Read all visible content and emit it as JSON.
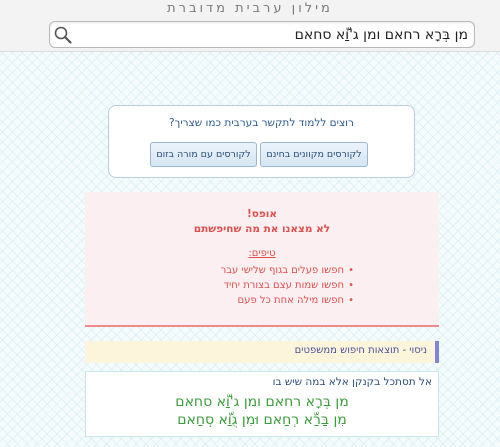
{
  "header": {
    "site_title": "מילון ערבית מדוברת"
  },
  "search": {
    "value": "מן בְּרָא רחאם ומן ג'וַّא סחאם",
    "icon": "search-icon"
  },
  "promo": {
    "title": "רוצים ללמוד לתקשר בערבית כמו שצריך?",
    "button_recorded": "לקורסים מקוונים בחינם",
    "button_zoom": "לקורסים עם מורה בזום"
  },
  "error": {
    "title": "אופס!",
    "subtitle": "לא מצאנו את מה שחיפשתם",
    "tips_label": "טיפים:",
    "tips": [
      "חפשו פעלים בגוף שלישי עבר",
      "חפשו שמות עצם בצורת יחיד",
      "חפשו מילה אחת כל פעם"
    ],
    "color": "#e0504e"
  },
  "attempt": {
    "label": "ניסוי - תוצאות חיפוש ממשפטים"
  },
  "result": {
    "heading": "אל תסתכל בקנקן אלא במה שיש בו",
    "line1": "מן בְּרָא רחאם ומן ג'וַّא סחאם",
    "line2": "מִן בַּרַّא רְחַאם וּמִן גֻוַّא סְחַאם",
    "color": "#3a9c3a"
  }
}
